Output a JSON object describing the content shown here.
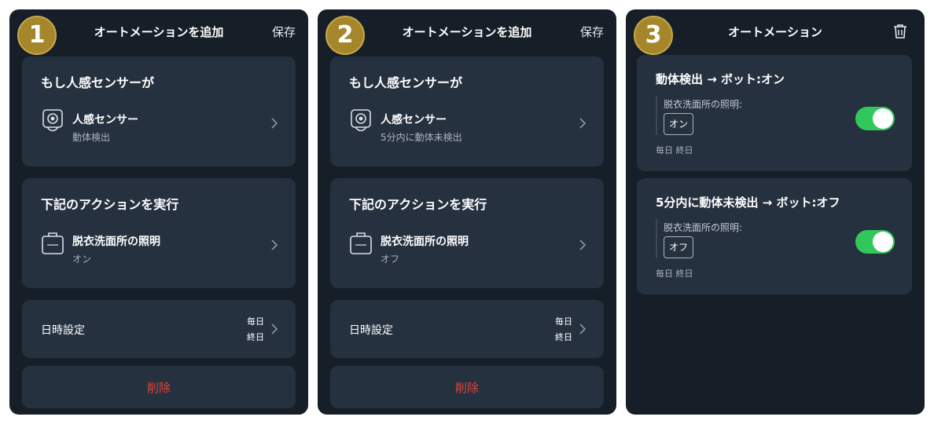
{
  "screens": [
    {
      "badge": "1",
      "header": {
        "title": "オートメーションを追加",
        "save_label": "保存"
      },
      "trigger_card": {
        "title": "もし人感センサーが",
        "device_name": "人感センサー",
        "device_state": "動体検出",
        "icon": "motion-sensor-icon"
      },
      "action_card": {
        "title": "下記のアクションを実行",
        "device_name": "脱衣洗面所の照明",
        "device_state": "オン",
        "icon": "switchbot-bot-icon"
      },
      "schedule_card": {
        "label": "日時設定",
        "days": "毎日",
        "time": "終日"
      },
      "delete_label": "削除"
    },
    {
      "badge": "2",
      "header": {
        "title": "オートメーションを追加",
        "save_label": "保存"
      },
      "trigger_card": {
        "title": "もし人感センサーが",
        "device_name": "人感センサー",
        "device_state": "5分内に動体未検出",
        "icon": "motion-sensor-icon"
      },
      "action_card": {
        "title": "下記のアクションを実行",
        "device_name": "脱衣洗面所の照明",
        "device_state": "オフ",
        "icon": "switchbot-bot-icon"
      },
      "schedule_card": {
        "label": "日時設定",
        "days": "毎日",
        "time": "終日"
      },
      "delete_label": "削除"
    },
    {
      "badge": "3",
      "header": {
        "title": "オートメーション",
        "trash_icon": "trash-icon"
      },
      "automations": [
        {
          "title": "動体検出 → ボット:オン",
          "device": "脱衣洗面所の照明:",
          "state": "オン",
          "schedule": "毎日 終日",
          "enabled": true
        },
        {
          "title": "5分内に動体未検出 → ボット:オフ",
          "device": "脱衣洗面所の照明:",
          "state": "オフ",
          "schedule": "毎日 終日",
          "enabled": true
        }
      ]
    }
  ],
  "colors": {
    "panel_bg": "#161e28",
    "card_bg": "#263140",
    "badge_gold": "#a5862a",
    "delete_red": "#e0443a",
    "toggle_green": "#32c75a"
  }
}
